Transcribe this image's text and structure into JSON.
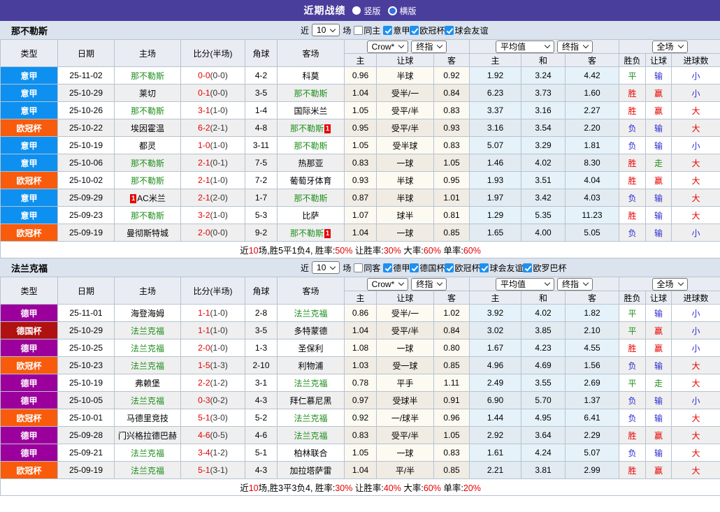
{
  "title_bar": {
    "title": "近期战绩",
    "radios": [
      {
        "label": "竖版",
        "selected": true
      },
      {
        "label": "横版",
        "selected": false
      }
    ]
  },
  "colors": {
    "accent_bar": "#4a3e9d",
    "checkbox_checked": "#1e90f0",
    "team_highlight": "#1e8e1e",
    "score_fulltime": "#e60000",
    "league": {
      "意甲": "#0d90f0",
      "欧冠杯": "#f85b0c",
      "德甲": "#9c009c",
      "德国杯": "#b01111"
    },
    "result": {
      "r": "#e60000",
      "g": "#1e8e1e",
      "b": "#2b2bd5"
    }
  },
  "sections": [
    {
      "team": "那不勒斯",
      "filters": {
        "recent_label": "近",
        "count": "10",
        "games_label": "场",
        "same_checkbox": {
          "label": "同主",
          "checked": false
        },
        "leagues": [
          {
            "label": "意甲",
            "checked": true
          },
          {
            "label": "欧冠杯",
            "checked": true
          },
          {
            "label": "球会友谊",
            "checked": true
          }
        ]
      },
      "header": {
        "columns": [
          "类型",
          "日期",
          "主场",
          "比分(半场)",
          "角球",
          "客场"
        ],
        "dropdowns": [
          "Crow*",
          "终指",
          "平均值",
          "终指",
          "全场"
        ],
        "sub": [
          "主",
          "让球",
          "客",
          "主",
          "和",
          "客",
          "胜负",
          "让球",
          "进球数"
        ]
      },
      "rows": [
        {
          "league": "意甲",
          "date": "25-11-02",
          "home": {
            "n": "那不勒斯",
            "self": true
          },
          "ft": "0-0",
          "ht": "0-0",
          "corner": "4-2",
          "away": {
            "n": "科莫"
          },
          "odds": [
            "0.96",
            "半球",
            "0.92"
          ],
          "avg": [
            "1.92",
            "3.24",
            "4.42"
          ],
          "res": [
            [
              "平",
              "g"
            ],
            [
              "输",
              "b"
            ],
            [
              "小",
              "b"
            ]
          ]
        },
        {
          "league": "意甲",
          "date": "25-10-29",
          "home": {
            "n": "莱切"
          },
          "ft": "0-1",
          "ht": "0-0",
          "corner": "3-5",
          "away": {
            "n": "那不勒斯",
            "self": true
          },
          "odds": [
            "1.04",
            "受半/一",
            "0.84"
          ],
          "avg": [
            "6.23",
            "3.73",
            "1.60"
          ],
          "res": [
            [
              "胜",
              "r"
            ],
            [
              "赢",
              "r"
            ],
            [
              "小",
              "b"
            ]
          ]
        },
        {
          "league": "意甲",
          "date": "25-10-26",
          "home": {
            "n": "那不勒斯",
            "self": true
          },
          "ft": "3-1",
          "ht": "1-0",
          "corner": "1-4",
          "away": {
            "n": "国际米兰"
          },
          "odds": [
            "1.05",
            "受平/半",
            "0.83"
          ],
          "avg": [
            "3.37",
            "3.16",
            "2.27"
          ],
          "res": [
            [
              "胜",
              "r"
            ],
            [
              "赢",
              "r"
            ],
            [
              "大",
              "r"
            ]
          ]
        },
        {
          "league": "欧冠杯",
          "date": "25-10-22",
          "home": {
            "n": "埃因霍温"
          },
          "ft": "6-2",
          "ht": "2-1",
          "corner": "4-8",
          "away": {
            "n": "那不勒斯",
            "self": true,
            "card": "1",
            "card_pos": "after"
          },
          "odds": [
            "0.95",
            "受平/半",
            "0.93"
          ],
          "avg": [
            "3.16",
            "3.54",
            "2.20"
          ],
          "res": [
            [
              "负",
              "b"
            ],
            [
              "输",
              "b"
            ],
            [
              "大",
              "r"
            ]
          ]
        },
        {
          "league": "意甲",
          "date": "25-10-19",
          "home": {
            "n": "都灵"
          },
          "ft": "1-0",
          "ht": "1-0",
          "corner": "3-11",
          "away": {
            "n": "那不勒斯",
            "self": true
          },
          "odds": [
            "1.05",
            "受半球",
            "0.83"
          ],
          "avg": [
            "5.07",
            "3.29",
            "1.81"
          ],
          "res": [
            [
              "负",
              "b"
            ],
            [
              "输",
              "b"
            ],
            [
              "小",
              "b"
            ]
          ]
        },
        {
          "league": "意甲",
          "date": "25-10-06",
          "home": {
            "n": "那不勒斯",
            "self": true
          },
          "ft": "2-1",
          "ht": "0-1",
          "corner": "7-5",
          "away": {
            "n": "热那亚"
          },
          "odds": [
            "0.83",
            "一球",
            "1.05"
          ],
          "avg": [
            "1.46",
            "4.02",
            "8.30"
          ],
          "res": [
            [
              "胜",
              "r"
            ],
            [
              "走",
              "g"
            ],
            [
              "大",
              "r"
            ]
          ]
        },
        {
          "league": "欧冠杯",
          "date": "25-10-02",
          "home": {
            "n": "那不勒斯",
            "self": true
          },
          "ft": "2-1",
          "ht": "1-0",
          "corner": "7-2",
          "away": {
            "n": "葡萄牙体育"
          },
          "odds": [
            "0.93",
            "半球",
            "0.95"
          ],
          "avg": [
            "1.93",
            "3.51",
            "4.04"
          ],
          "res": [
            [
              "胜",
              "r"
            ],
            [
              "赢",
              "r"
            ],
            [
              "大",
              "r"
            ]
          ]
        },
        {
          "league": "意甲",
          "date": "25-09-29",
          "home": {
            "n": "AC米兰",
            "card": "1",
            "card_pos": "before"
          },
          "ft": "2-1",
          "ht": "2-0",
          "corner": "1-7",
          "away": {
            "n": "那不勒斯",
            "self": true
          },
          "odds": [
            "0.87",
            "半球",
            "1.01"
          ],
          "avg": [
            "1.97",
            "3.42",
            "4.03"
          ],
          "res": [
            [
              "负",
              "b"
            ],
            [
              "输",
              "b"
            ],
            [
              "大",
              "r"
            ]
          ]
        },
        {
          "league": "意甲",
          "date": "25-09-23",
          "home": {
            "n": "那不勒斯",
            "self": true
          },
          "ft": "3-2",
          "ht": "1-0",
          "corner": "5-3",
          "away": {
            "n": "比萨"
          },
          "odds": [
            "1.07",
            "球半",
            "0.81"
          ],
          "avg": [
            "1.29",
            "5.35",
            "11.23"
          ],
          "res": [
            [
              "胜",
              "r"
            ],
            [
              "输",
              "b"
            ],
            [
              "大",
              "r"
            ]
          ]
        },
        {
          "league": "欧冠杯",
          "date": "25-09-19",
          "home": {
            "n": "曼彻斯特城"
          },
          "ft": "2-0",
          "ht": "0-0",
          "corner": "9-2",
          "away": {
            "n": "那不勒斯",
            "self": true,
            "card": "1",
            "card_pos": "after"
          },
          "odds": [
            "1.04",
            "一球",
            "0.85"
          ],
          "avg": [
            "1.65",
            "4.00",
            "5.05"
          ],
          "res": [
            [
              "负",
              "b"
            ],
            [
              "输",
              "b"
            ],
            [
              "小",
              "b"
            ]
          ]
        }
      ],
      "summary": [
        [
          "近",
          false
        ],
        [
          "10",
          true
        ],
        [
          "场,胜5平1负4, 胜率:",
          false
        ],
        [
          "50%",
          true
        ],
        [
          " 让胜率:",
          false
        ],
        [
          "30%",
          true
        ],
        [
          " 大率:",
          false
        ],
        [
          "60%",
          true
        ],
        [
          " 单率:",
          false
        ],
        [
          "60%",
          true
        ]
      ]
    },
    {
      "team": "法兰克福",
      "filters": {
        "recent_label": "近",
        "count": "10",
        "games_label": "场",
        "same_checkbox": {
          "label": "同客",
          "checked": false
        },
        "leagues": [
          {
            "label": "德甲",
            "checked": true
          },
          {
            "label": "德国杯",
            "checked": true
          },
          {
            "label": "欧冠杯",
            "checked": true
          },
          {
            "label": "球会友谊",
            "checked": true
          },
          {
            "label": "欧罗巴杯",
            "checked": true
          }
        ]
      },
      "header": {
        "columns": [
          "类型",
          "日期",
          "主场",
          "比分(半场)",
          "角球",
          "客场"
        ],
        "dropdowns": [
          "Crow*",
          "终指",
          "平均值",
          "终指",
          "全场"
        ],
        "sub": [
          "主",
          "让球",
          "客",
          "主",
          "和",
          "客",
          "胜负",
          "让球",
          "进球数"
        ]
      },
      "rows": [
        {
          "league": "德甲",
          "date": "25-11-01",
          "home": {
            "n": "海登海姆"
          },
          "ft": "1-1",
          "ht": "1-0",
          "corner": "2-8",
          "away": {
            "n": "法兰克福",
            "self": true
          },
          "odds": [
            "0.86",
            "受半/一",
            "1.02"
          ],
          "avg": [
            "3.92",
            "4.02",
            "1.82"
          ],
          "res": [
            [
              "平",
              "g"
            ],
            [
              "输",
              "b"
            ],
            [
              "小",
              "b"
            ]
          ]
        },
        {
          "league": "德国杯",
          "date": "25-10-29",
          "home": {
            "n": "法兰克福",
            "self": true
          },
          "ft": "1-1",
          "ht": "1-0",
          "corner": "3-5",
          "away": {
            "n": "多特蒙德"
          },
          "odds": [
            "1.04",
            "受平/半",
            "0.84"
          ],
          "avg": [
            "3.02",
            "3.85",
            "2.10"
          ],
          "res": [
            [
              "平",
              "g"
            ],
            [
              "赢",
              "r"
            ],
            [
              "小",
              "b"
            ]
          ]
        },
        {
          "league": "德甲",
          "date": "25-10-25",
          "home": {
            "n": "法兰克福",
            "self": true
          },
          "ft": "2-0",
          "ht": "1-0",
          "corner": "1-3",
          "away": {
            "n": "圣保利"
          },
          "odds": [
            "1.08",
            "一球",
            "0.80"
          ],
          "avg": [
            "1.67",
            "4.23",
            "4.55"
          ],
          "res": [
            [
              "胜",
              "r"
            ],
            [
              "赢",
              "r"
            ],
            [
              "小",
              "b"
            ]
          ]
        },
        {
          "league": "欧冠杯",
          "date": "25-10-23",
          "home": {
            "n": "法兰克福",
            "self": true
          },
          "ft": "1-5",
          "ht": "1-3",
          "corner": "2-10",
          "away": {
            "n": "利物浦"
          },
          "odds": [
            "1.03",
            "受一球",
            "0.85"
          ],
          "avg": [
            "4.96",
            "4.69",
            "1.56"
          ],
          "res": [
            [
              "负",
              "b"
            ],
            [
              "输",
              "b"
            ],
            [
              "大",
              "r"
            ]
          ]
        },
        {
          "league": "德甲",
          "date": "25-10-19",
          "home": {
            "n": "弗赖堡"
          },
          "ft": "2-2",
          "ht": "1-2",
          "corner": "3-1",
          "away": {
            "n": "法兰克福",
            "self": true
          },
          "odds": [
            "0.78",
            "平手",
            "1.11"
          ],
          "avg": [
            "2.49",
            "3.55",
            "2.69"
          ],
          "res": [
            [
              "平",
              "g"
            ],
            [
              "走",
              "g"
            ],
            [
              "大",
              "r"
            ]
          ]
        },
        {
          "league": "德甲",
          "date": "25-10-05",
          "home": {
            "n": "法兰克福",
            "self": true
          },
          "ft": "0-3",
          "ht": "0-2",
          "corner": "4-3",
          "away": {
            "n": "拜仁慕尼黑"
          },
          "odds": [
            "0.97",
            "受球半",
            "0.91"
          ],
          "avg": [
            "6.90",
            "5.70",
            "1.37"
          ],
          "res": [
            [
              "负",
              "b"
            ],
            [
              "输",
              "b"
            ],
            [
              "小",
              "b"
            ]
          ]
        },
        {
          "league": "欧冠杯",
          "date": "25-10-01",
          "home": {
            "n": "马德里竞技"
          },
          "ft": "5-1",
          "ht": "3-0",
          "corner": "5-2",
          "away": {
            "n": "法兰克福",
            "self": true
          },
          "odds": [
            "0.92",
            "一/球半",
            "0.96"
          ],
          "avg": [
            "1.44",
            "4.95",
            "6.41"
          ],
          "res": [
            [
              "负",
              "b"
            ],
            [
              "输",
              "b"
            ],
            [
              "大",
              "r"
            ]
          ]
        },
        {
          "league": "德甲",
          "date": "25-09-28",
          "home": {
            "n": "门兴格拉德巴赫"
          },
          "ft": "4-6",
          "ht": "0-5",
          "corner": "4-6",
          "away": {
            "n": "法兰克福",
            "self": true
          },
          "odds": [
            "0.83",
            "受平/半",
            "1.05"
          ],
          "avg": [
            "2.92",
            "3.64",
            "2.29"
          ],
          "res": [
            [
              "胜",
              "r"
            ],
            [
              "赢",
              "r"
            ],
            [
              "大",
              "r"
            ]
          ]
        },
        {
          "league": "德甲",
          "date": "25-09-21",
          "home": {
            "n": "法兰克福",
            "self": true
          },
          "ft": "3-4",
          "ht": "1-2",
          "corner": "5-1",
          "away": {
            "n": "柏林联合"
          },
          "odds": [
            "1.05",
            "一球",
            "0.83"
          ],
          "avg": [
            "1.61",
            "4.24",
            "5.07"
          ],
          "res": [
            [
              "负",
              "b"
            ],
            [
              "输",
              "b"
            ],
            [
              "大",
              "r"
            ]
          ]
        },
        {
          "league": "欧冠杯",
          "date": "25-09-19",
          "home": {
            "n": "法兰克福",
            "self": true
          },
          "ft": "5-1",
          "ht": "3-1",
          "corner": "4-3",
          "away": {
            "n": "加拉塔萨雷"
          },
          "odds": [
            "1.04",
            "平/半",
            "0.85"
          ],
          "avg": [
            "2.21",
            "3.81",
            "2.99"
          ],
          "res": [
            [
              "胜",
              "r"
            ],
            [
              "赢",
              "r"
            ],
            [
              "大",
              "r"
            ]
          ]
        }
      ],
      "summary": [
        [
          "近",
          false
        ],
        [
          "10",
          true
        ],
        [
          "场,胜3平3负4, 胜率:",
          false
        ],
        [
          "30%",
          true
        ],
        [
          " 让胜率:",
          false
        ],
        [
          "40%",
          true
        ],
        [
          " 大率:",
          false
        ],
        [
          "60%",
          true
        ],
        [
          " 单率:",
          false
        ],
        [
          "20%",
          true
        ]
      ]
    }
  ]
}
